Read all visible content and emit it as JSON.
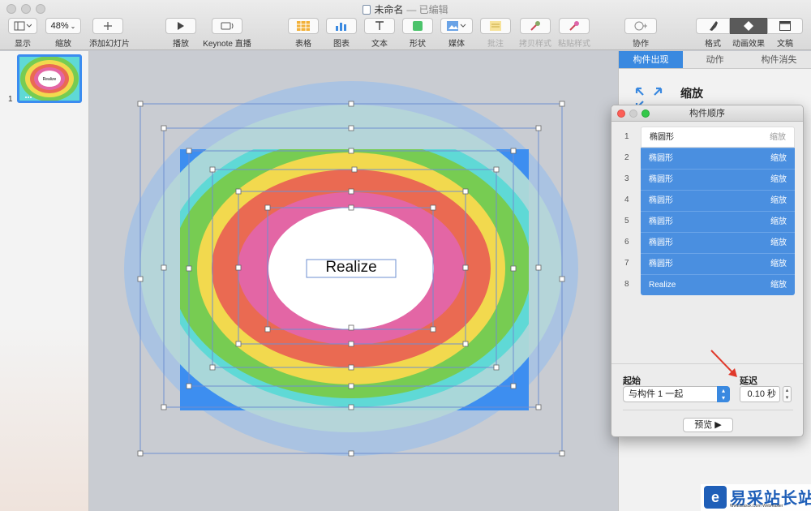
{
  "window": {
    "title": "未命名",
    "status": "— 已编辑"
  },
  "toolbar": {
    "view_label": "显示",
    "zoom_value": "48%",
    "zoom_label": "缩放",
    "add_slide_label": "添加幻灯片",
    "play_label": "播放",
    "keynote_live_label": "Keynote 直播",
    "table_label": "表格",
    "chart_label": "图表",
    "text_label": "文本",
    "shape_label": "形状",
    "media_label": "媒体",
    "comment_label": "批注",
    "copy_style_label": "拷贝样式",
    "paste_style_label": "粘贴样式",
    "collaborate_label": "协作",
    "format_label": "格式",
    "animate_label": "动画效果",
    "document_label": "文稿"
  },
  "navigator": {
    "slide_number": "1",
    "thumb_text": "Realize"
  },
  "slide": {
    "text": "Realize",
    "colors": {
      "background": "#3d8ef0",
      "ring_outer_light": "#a9c4e2",
      "ring_outer_mid": "#b7d6d8",
      "cyan": "#5fd9d6",
      "green": "#77cc52",
      "yellow": "#f2d94e",
      "orange": "#ea6a52",
      "pink": "#e366a5",
      "white": "#ffffff"
    }
  },
  "inspector": {
    "tabs": [
      "构件出现",
      "动作",
      "构件消失"
    ],
    "effect_name": "缩放"
  },
  "build_order": {
    "title": "构件顺序",
    "items": [
      {
        "num": "1",
        "name": "椭圆形",
        "effect": "缩放"
      },
      {
        "num": "2",
        "name": "椭圆形",
        "effect": "缩放"
      },
      {
        "num": "3",
        "name": "椭圆形",
        "effect": "缩放"
      },
      {
        "num": "4",
        "name": "椭圆形",
        "effect": "缩放"
      },
      {
        "num": "5",
        "name": "椭圆形",
        "effect": "缩放"
      },
      {
        "num": "6",
        "name": "椭圆形",
        "effect": "缩放"
      },
      {
        "num": "7",
        "name": "椭圆形",
        "effect": "缩放"
      },
      {
        "num": "8",
        "name": "Realize",
        "effect": "缩放"
      }
    ],
    "start_label": "起始",
    "start_value": "与构件 1 一起",
    "delay_label": "延迟",
    "delay_value": "0.10 秒",
    "preview_label": "预览"
  },
  "watermark": {
    "text": "易采站长站",
    "sub": "Www.Easck.Com Webmaster"
  }
}
